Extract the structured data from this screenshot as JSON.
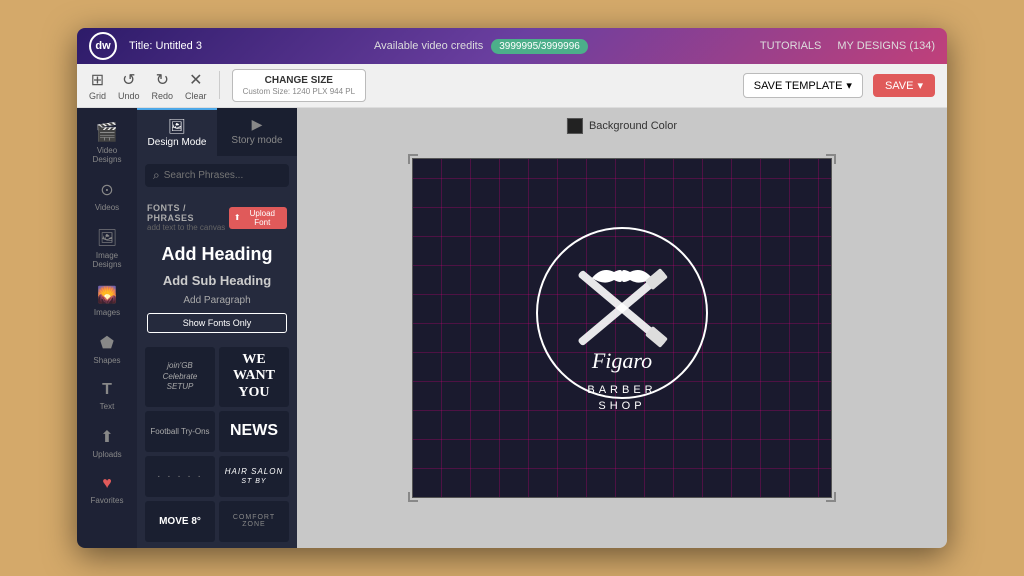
{
  "app": {
    "logo": "dw",
    "title_label": "Title:",
    "title_value": "Untitled 3",
    "credits_label": "Available video credits",
    "credits_value": "3999995/3999996",
    "nav_tutorials": "TUTORIALS",
    "nav_my_designs": "MY DESIGNS (134)"
  },
  "toolbar": {
    "grid_label": "Grid",
    "undo_label": "Undo",
    "redo_label": "Redo",
    "clear_label": "Clear",
    "change_size_title": "CHANGE SIZE",
    "change_size_sub": "Custom Size: 1240 PLX 944 PL",
    "save_template_label": "SAVE TEMPLATE",
    "save_label": "SAVE"
  },
  "mode_tabs": [
    {
      "label": "Design Mode",
      "icon": "🖼"
    },
    {
      "label": "Story mode",
      "icon": "▶"
    }
  ],
  "search": {
    "placeholder": "Search Phrases..."
  },
  "fonts_section": {
    "title": "FONTS / PHRASES",
    "subtitle": "add text to the canvas",
    "upload_label": "Upload Font",
    "add_heading": "Add Heading",
    "add_sub_heading": "Add Sub Heading",
    "add_paragraph": "Add Paragraph",
    "show_fonts_btn": "Show Fonts Only"
  },
  "sidebar_items": [
    {
      "id": "video-designs",
      "label": "Video Designs",
      "icon": "🎬"
    },
    {
      "id": "videos",
      "label": "Videos",
      "icon": "▶"
    },
    {
      "id": "image-designs",
      "label": "Image Designs",
      "icon": "🖼"
    },
    {
      "id": "images",
      "label": "Images",
      "icon": "🌄"
    },
    {
      "id": "shapes",
      "label": "Shapes",
      "icon": "⬟"
    },
    {
      "id": "text",
      "label": "Text",
      "icon": "T"
    },
    {
      "id": "uploads",
      "label": "Uploads",
      "icon": "⬆"
    },
    {
      "id": "favorites",
      "label": "Favorites",
      "icon": "♥"
    }
  ],
  "canvas": {
    "bg_color_label": "Background Color",
    "design_title": "Figaro",
    "barber_shop": "BARBER\nSHOP"
  },
  "font_samples": [
    {
      "id": "f1",
      "style": "italic_script",
      "text": "join'GB\nCelebrate\nSETUP"
    },
    {
      "id": "f2",
      "style": "bold_serif",
      "text": "WE\nWANT\nYOU"
    },
    {
      "id": "f3",
      "style": "football",
      "text": "Football Try-Ons"
    },
    {
      "id": "f4",
      "style": "news",
      "text": "NEWS"
    },
    {
      "id": "f5",
      "style": "dotted",
      "text": "........"
    },
    {
      "id": "f6",
      "style": "hair_salon",
      "text": "HAIR SALON\nST BY"
    },
    {
      "id": "f7",
      "style": "move",
      "text": "MOVE 8°"
    },
    {
      "id": "f8",
      "style": "comfort",
      "text": "COMFORT ZONE"
    }
  ]
}
